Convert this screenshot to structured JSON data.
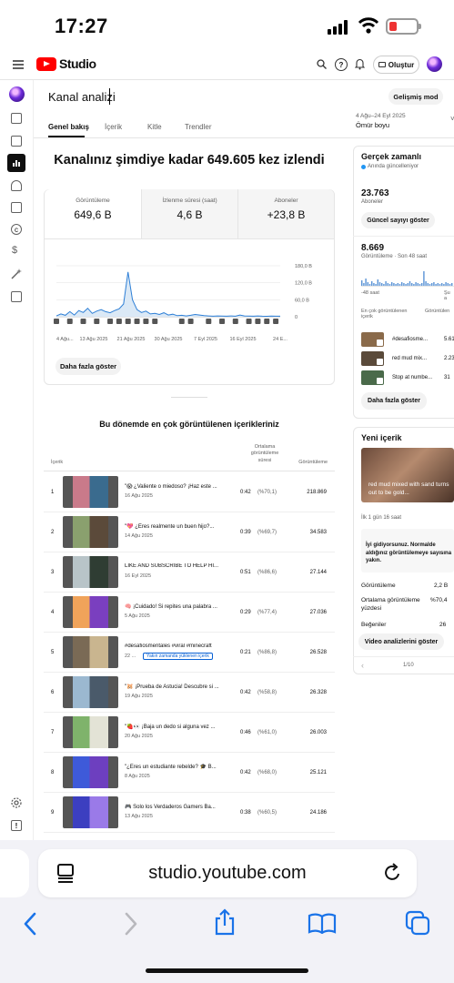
{
  "status_bar": {
    "time": "17:27"
  },
  "header": {
    "brand": "Studio",
    "create_label": "Oluştur"
  },
  "page": {
    "title": "Kanal analizi",
    "advanced_mode": "Gelişmiş mod",
    "tabs": [
      "Genel bakış",
      "İçerik",
      "Kitle",
      "Trendler"
    ],
    "date_range": "4 Ağu–24 Eyl 2025",
    "date_preset": "Ömür boyu",
    "headline": "Kanalınız şimdiye kadar 649.605 kez izlendi"
  },
  "metrics": [
    {
      "label": "Görüntüleme",
      "value": "649,6 B"
    },
    {
      "label": "İzlenme süresi (saat)",
      "value": "4,6 B"
    },
    {
      "label": "Aboneler",
      "value": "+23,8 B"
    }
  ],
  "chart_data": {
    "type": "line",
    "x_ticks": [
      "4 Ağu...",
      "13 Ağu 2025",
      "21 Ağu 2025",
      "30 Ağu 2025",
      "7 Eyl 2025",
      "16 Eyl 2025",
      "24 E..."
    ],
    "y_ticks": [
      "180,0 B",
      "120,0 B",
      "60,0 B",
      "0"
    ],
    "ylim": [
      0,
      180000
    ],
    "series": [
      {
        "values": [
          3000,
          10000,
          5000,
          18000,
          6000,
          22000,
          15000,
          30000,
          12000,
          20000,
          25000,
          18000,
          14000,
          22000,
          28000,
          45000,
          158000,
          60000,
          25000,
          15000,
          20000,
          10000,
          12000,
          8000,
          14000,
          6000,
          9000,
          4000,
          5000,
          3000,
          5000,
          8000,
          6000,
          4000,
          3000,
          2000,
          3000,
          2500,
          2000,
          3000,
          2000,
          6000,
          3000,
          2500,
          2000,
          3000,
          2000,
          1500,
          2500,
          2000,
          1800
        ]
      }
    ],
    "grid": true
  },
  "show_more": "Daha fazla göster",
  "top_content": {
    "title": "Bu dönemde en çok görüntülenen içerikleriniz",
    "col_content": "İçerik",
    "col_duration": "Ortalama görüntüleme süresi",
    "col_views": "Görüntüleme",
    "badge": "Yakın zamanda yüklenen içerik",
    "rows": [
      {
        "rank": "1",
        "title": "\"😱 ¿Valiente o miedoso? ¡Haz este ...",
        "date": "16 Ağu 2025",
        "duration": "0:42",
        "pct": "(%70,1)",
        "views": "218.869"
      },
      {
        "rank": "2",
        "title": "\"💖 ¿Eres realmente un buen hijo?...",
        "date": "14 Ağu 2025",
        "duration": "0:39",
        "pct": "(%69,7)",
        "views": "34.583"
      },
      {
        "rank": "3",
        "title": "LIKE AND SUBSCRIBE TO HELP HI...",
        "date": "16 Eyl 2025",
        "duration": "0:51",
        "pct": "(%86,6)",
        "views": "27.144"
      },
      {
        "rank": "4",
        "title": "🧠 ¡Cuidado! Si repites una palabra ...",
        "date": "5 Ağu 2025",
        "duration": "0:29",
        "pct": "(%77,4)",
        "views": "27.036"
      },
      {
        "rank": "5",
        "title": "#desafiosmentales #viral #minecraft",
        "date": "22 ...",
        "duration": "0:21",
        "pct": "(%86,8)",
        "views": "26.528"
      },
      {
        "rank": "6",
        "title": "\"🐹 ¡Prueba de Astucia! Descubre si ...",
        "date": "19 Ağu 2025",
        "duration": "0:42",
        "pct": "(%58,8)",
        "views": "26.328"
      },
      {
        "rank": "7",
        "title": "\"🍓👀 ¡Baja un dedo si alguna vez ...",
        "date": "20 Ağu 2025",
        "duration": "0:46",
        "pct": "(%61,0)",
        "views": "26.003"
      },
      {
        "rank": "8",
        "title": "\"¿Eres un estudiante rebelde? 🎓 B...",
        "date": "8 Ağu 2025",
        "duration": "0:42",
        "pct": "(%68,0)",
        "views": "25.121"
      },
      {
        "rank": "9",
        "title": "🎮 Solo los Verdaderos Gamers Ba...",
        "date": "13 Ağu 2025",
        "duration": "0:38",
        "pct": "(%60,5)",
        "views": "24.186"
      }
    ]
  },
  "realtime": {
    "title": "Gerçek zamanlı",
    "live": "Anında güncelleniyor",
    "subs_value": "23.763",
    "subs_label": "Aboneler",
    "subs_btn": "Güncel sayıyı göster",
    "views_value": "8.669",
    "views_label": "Görüntüleme · Son 48 saat",
    "axis_left": "-48 saat",
    "axis_right": "Şu a",
    "col_left": "En çok görüntülenen içerik",
    "col_right": "Görüntülen",
    "items": [
      {
        "title": "#desafiosme...",
        "value": "5.61"
      },
      {
        "title": "red mud mix...",
        "value": "2.23"
      },
      {
        "title": "Stop at numbe...",
        "value": "31"
      }
    ],
    "more": "Daha fazla göster"
  },
  "new_content": {
    "title": "Yeni içerik",
    "video_title": "red mud mixed with sand turns out to be gold...",
    "age": "İlk 1 gün 16 saat",
    "note": "İyi gidiyorsunuz. Normalde aldığınız görüntülemeye sayısına yakın.",
    "stats": [
      {
        "label": "Görüntüleme",
        "value": "2,2 B"
      },
      {
        "label": "Ortalama görüntüleme yüzdesi",
        "value": "%70,4"
      },
      {
        "label": "Beğeniler",
        "value": "26"
      }
    ],
    "btn": "Video analizlerini göster",
    "pager": "1/10"
  },
  "browser": {
    "url": "studio.youtube.com"
  }
}
